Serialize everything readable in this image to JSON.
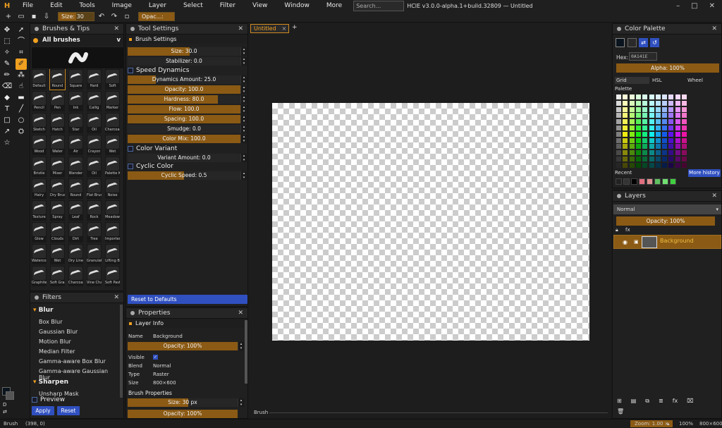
{
  "app": {
    "logo": "H",
    "title": "HCIE v3.0.0-alpha.1+build.32809 — Untitled"
  },
  "menu": [
    "File",
    "Edit",
    "Tools",
    "Image",
    "Layer",
    "Select",
    "Filter",
    "View",
    "Window",
    "More"
  ],
  "search": {
    "placeholder": "Search..."
  },
  "window_controls": [
    "–",
    "□",
    "✕"
  ],
  "toolbar": {
    "size_label": "Size: 30 px",
    "opacity_label": "Opac...: 100%",
    "size_fraction": 0.5,
    "opacity_fraction": 1.0
  },
  "brushes_panel": {
    "title": "Brushes & Tips",
    "category": "All brushes",
    "brushes": [
      "Default",
      "Round",
      "Square",
      "Hard",
      "Soft",
      "Pencil",
      "Pen",
      "Ink",
      "Callig",
      "Marker",
      "Sketch",
      "Hatch",
      "Star",
      "Oil",
      "Charcoal",
      "Wood",
      "Water",
      "Air",
      "Crayon",
      "Wet",
      "Bristle",
      "Mixer",
      "Blender",
      "Oil",
      "Palette K",
      "Hairy",
      "Dry Brush",
      "Round",
      "Flat Brus",
      "Noise",
      "Texture",
      "Spray",
      "Leaf",
      "Rock",
      "Meadow",
      "Glow",
      "Clouds",
      "Dirt",
      "Tree",
      "Imported",
      "Watercolo",
      "Wet",
      "Dry Line",
      "Granulati",
      "Lifting B",
      "Graphite",
      "Soft Grap",
      "Charcoal",
      "Vine Char",
      "Soft Past"
    ]
  },
  "tool_settings": {
    "title": "Tool Settings",
    "brush_settings": "Brush Settings",
    "size": "Size: 30.0",
    "size_fraction": 0.55,
    "stabilizer": "Stabilizer: 0.0",
    "dynamics": "Speed Dynamics",
    "dynamics_amount": "Dynamics Amount: 25.0",
    "dynamics_fraction": 0.25,
    "opacity": "Opacity: 100.0",
    "hardness": "Hardness: 80.0",
    "hardness_fraction": 0.8,
    "flow": "Flow: 100.0",
    "spacing": "Spacing: 100.0",
    "smudge": "Smudge: 0.0",
    "color_mix": "Color Mix: 100.0",
    "color_variant": "Color Variant",
    "variant_amount": "Variant Amount: 0.0",
    "cyclic_color": "Cyclic Color",
    "cyclic_speed": "Cyclic Speed: 0.5",
    "cyclic_fraction": 0.5,
    "reset": "Reset to Defaults"
  },
  "filters": {
    "title": "Filters",
    "blur": "Blur",
    "blur_items": [
      "Box Blur",
      "Gaussian Blur",
      "Motion Blur",
      "Median Filter",
      "Gamma-aware Box Blur",
      "Gamma-aware Gaussian Blur"
    ],
    "sharpen": "Sharpen",
    "sharpen_items": [
      "Unsharp Mask"
    ],
    "preview": "Preview",
    "apply": "Apply",
    "reset": "Reset"
  },
  "properties": {
    "title": "Properties",
    "layer_info": "Layer Info",
    "name_k": "Name",
    "name_v": "Background",
    "opacity": "Opacity: 100%",
    "visible_k": "Visible",
    "blend_k": "Blend",
    "blend_v": "Normal",
    "type_k": "Type",
    "type_v": "Raster",
    "size_k": "Size",
    "size_v": "800×600",
    "brush_props": "Brush Properties",
    "brush_size": "Size: 30 px",
    "brush_size_fraction": 0.55,
    "brush_opacity": "Opacity: 100%"
  },
  "document": {
    "tab": "Untitled",
    "tab_close": "×",
    "add": "+",
    "brush_label": "Brush"
  },
  "color_palette": {
    "title": "Color Palette",
    "hex_label": "Hex:",
    "hex_value": "0A141E",
    "alpha": "Alpha: 100%",
    "tabs": [
      "Grid",
      "HSL",
      "Wheel"
    ],
    "palette_label": "Palette",
    "recent_label": "Recent",
    "more_history": "More history",
    "recent_colors": [
      "#222222",
      "#333333",
      "#000000",
      "#e07080",
      "#e09090",
      "#60c060",
      "#70e070",
      "#40d040"
    ],
    "fg": "#0A141E",
    "bg": "#2a2a2a"
  },
  "layers": {
    "title": "Layers",
    "blend": "Normal",
    "opacity": "Opacity: 100%",
    "layer_name": "Background"
  },
  "status": {
    "tool": "Brush",
    "coords": "(398, 0)",
    "zoom": "Zoom: 1.00 ×",
    "zoom_pct": "100%",
    "size": "800×600"
  }
}
